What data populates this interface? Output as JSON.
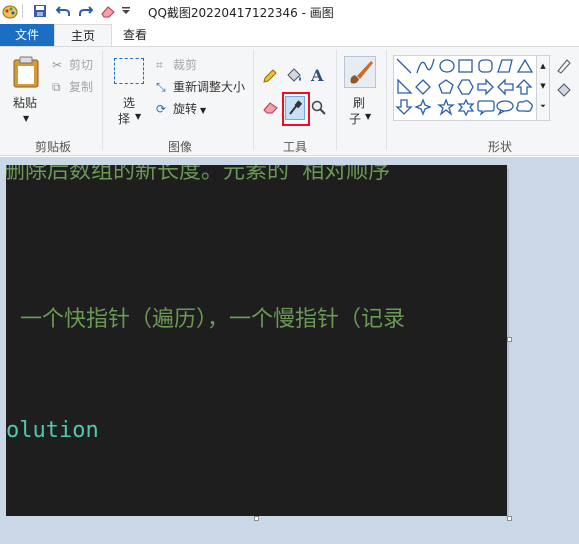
{
  "window": {
    "title": "QQ截图20220417122346 - 画图"
  },
  "tabs": {
    "file": "文件",
    "home": "主页",
    "view": "查看"
  },
  "clipboard": {
    "paste": "粘贴",
    "cut": "剪切",
    "copy": "复制",
    "group": "剪贴板"
  },
  "image": {
    "select_line1": "选",
    "select_line2": "择",
    "crop": "裁剪",
    "resize": "重新调整大小",
    "rotate": "旋转",
    "group": "图像"
  },
  "tools": {
    "group": "工具",
    "selected_tool": "color-picker"
  },
  "brush": {
    "line1": "刷",
    "line2": "子"
  },
  "shapes": {
    "group": "形状"
  },
  "canvas_text": {
    "line1": "删除后数组的新长度。元素的 相对顺序",
    "line2": "：一个快指针（遍历），一个慢指针（记录",
    "line3": "olution"
  },
  "colors": {
    "accent": "#1b6ec2",
    "canvas_bg": "#1e1e1e",
    "green_text": "#6a9955",
    "teal_text": "#4ec9b0",
    "highlight": "#e81123"
  }
}
